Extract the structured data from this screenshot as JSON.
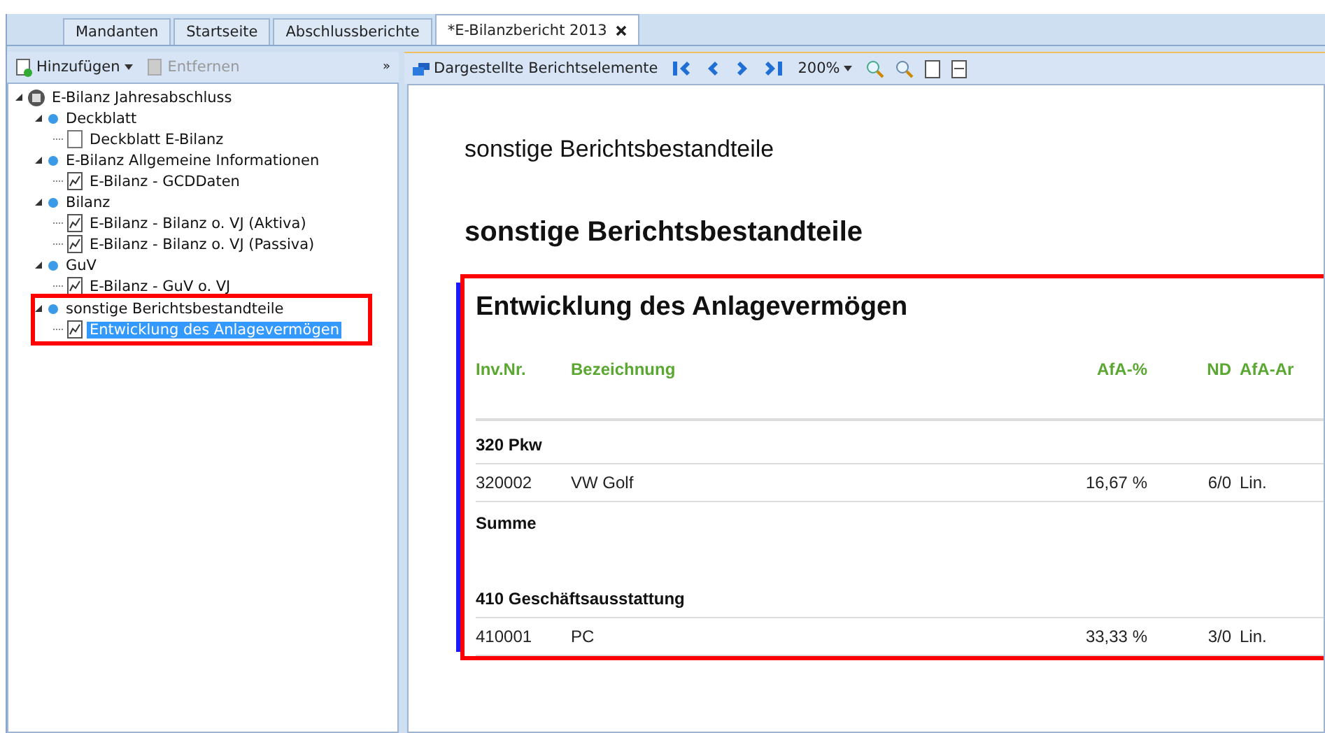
{
  "tabs": [
    {
      "label": "Mandanten",
      "selected": false,
      "closable": false
    },
    {
      "label": "Startseite",
      "selected": false,
      "closable": false
    },
    {
      "label": "Abschlussberichte",
      "selected": false,
      "closable": false
    },
    {
      "label": "*E-Bilanzbericht 2013",
      "selected": true,
      "closable": true
    }
  ],
  "left_toolbar": {
    "add": {
      "label": "Hinzufügen",
      "disabled": false
    },
    "remove": {
      "label": "Entfernen",
      "disabled": true
    },
    "overflow": "»"
  },
  "tree": [
    {
      "kind": "root",
      "label": "E-Bilanz Jahresabschluss",
      "expanded": true,
      "selected": false,
      "children": [
        {
          "kind": "group",
          "label": "Deckblatt",
          "expanded": true,
          "selected": false,
          "children": [
            {
              "kind": "page",
              "label": "Deckblatt E-Bilanz",
              "selected": false
            }
          ]
        },
        {
          "kind": "group",
          "label": "E-Bilanz Allgemeine Informationen",
          "expanded": true,
          "selected": false,
          "children": [
            {
              "kind": "report",
              "label": "E-Bilanz - GCDDaten",
              "selected": false
            }
          ]
        },
        {
          "kind": "group",
          "label": "Bilanz",
          "expanded": true,
          "selected": false,
          "children": [
            {
              "kind": "report",
              "label": "E-Bilanz - Bilanz o. VJ (Aktiva)",
              "selected": false
            },
            {
              "kind": "report",
              "label": "E-Bilanz - Bilanz o. VJ (Passiva)",
              "selected": false
            }
          ]
        },
        {
          "kind": "group",
          "label": "GuV",
          "expanded": true,
          "selected": false,
          "children": [
            {
              "kind": "report",
              "label": "E-Bilanz - GuV o. VJ",
              "selected": false
            }
          ]
        },
        {
          "kind": "group",
          "label": "sonstige Berichtsbestandteile",
          "expanded": true,
          "selected": false,
          "highlighted": true,
          "children": [
            {
              "kind": "report",
              "label": "Entwicklung des Anlagevermögen",
              "selected": true
            }
          ]
        }
      ]
    }
  ],
  "report_toolbar": {
    "elements_button": "Dargestellte Berichtselemente",
    "zoom": "200%"
  },
  "document": {
    "page_header": "sonstige Berichtsbestandteile",
    "section_title": "sonstige Berichtsbestandteile",
    "report": {
      "title": "Entwicklung des Anlagevermögen",
      "highlighted": true,
      "columns": [
        "Inv.Nr.",
        "Bezeichnung",
        "AfA-%",
        "ND",
        "AfA-Ar"
      ],
      "rows": [
        {
          "kind": "group",
          "label": "320 Pkw"
        },
        {
          "kind": "item",
          "cells": [
            "320002",
            "VW Golf",
            "16,67 %",
            "6/0",
            "Lin."
          ]
        },
        {
          "kind": "sum",
          "label": "Summe"
        },
        {
          "kind": "group",
          "label": "410 Geschäftsausstattung"
        },
        {
          "kind": "item",
          "cells": [
            "410001",
            "PC",
            "33,33 %",
            "3/0",
            "Lin."
          ]
        }
      ]
    }
  }
}
